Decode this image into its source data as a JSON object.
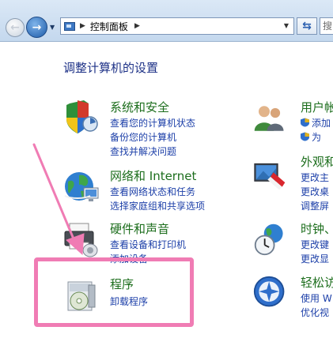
{
  "address_bar": {
    "path_label": "控制面板"
  },
  "search": {
    "placeholder": "搜"
  },
  "page": {
    "heading": "调整计算机的设置"
  },
  "categories": {
    "system_security": {
      "title": "系统和安全",
      "links": [
        "查看您的计算机状态",
        "备份您的计算机",
        "查找并解决问题"
      ]
    },
    "network": {
      "title": "网络和 Internet",
      "links": [
        "查看网络状态和任务",
        "选择家庭组和共享选项"
      ]
    },
    "hardware": {
      "title": "硬件和声音",
      "links": [
        "查看设备和打印机",
        "添加设备"
      ]
    },
    "programs": {
      "title": "程序",
      "links": [
        "卸载程序"
      ]
    },
    "user_accounts": {
      "title": "用户帐",
      "links": [
        "添加",
        "为"
      ]
    },
    "appearance": {
      "title": "外观和",
      "links": [
        "更改主",
        "更改桌",
        "调整屏"
      ]
    },
    "clock": {
      "title": "时钟、",
      "links": [
        "更改键",
        "更改显"
      ]
    },
    "ease_access": {
      "title": "轻松访",
      "links": [
        "使用 W",
        "优化视"
      ]
    }
  },
  "colors": {
    "category_title": "#1d6e1d",
    "link": "#1c3fa8",
    "heading": "#1e3287",
    "highlight": "#f07cb4"
  }
}
